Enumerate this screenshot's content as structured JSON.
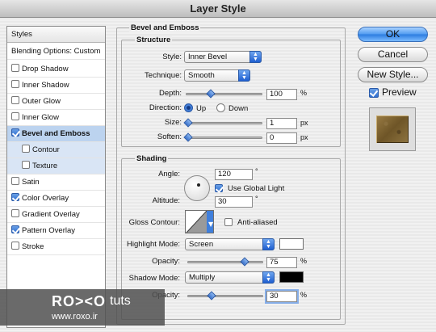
{
  "window": {
    "title": "Layer Style"
  },
  "sidebar": {
    "header": "Styles",
    "blending": "Blending Options: Custom",
    "items": [
      {
        "label": "Drop Shadow",
        "checked": false
      },
      {
        "label": "Inner Shadow",
        "checked": false
      },
      {
        "label": "Outer Glow",
        "checked": false
      },
      {
        "label": "Inner Glow",
        "checked": false
      },
      {
        "label": "Bevel and Emboss",
        "checked": true
      },
      {
        "label": "Contour",
        "checked": false
      },
      {
        "label": "Texture",
        "checked": false
      },
      {
        "label": "Satin",
        "checked": false
      },
      {
        "label": "Color Overlay",
        "checked": true
      },
      {
        "label": "Gradient Overlay",
        "checked": false
      },
      {
        "label": "Pattern Overlay",
        "checked": true
      },
      {
        "label": "Stroke",
        "checked": false
      }
    ]
  },
  "bevel": {
    "title": "Bevel and Emboss",
    "structure_title": "Structure",
    "style_label": "Style:",
    "style_value": "Inner Bevel",
    "technique_label": "Technique:",
    "technique_value": "Smooth",
    "depth_label": "Depth:",
    "depth_value": "100",
    "depth_unit": "%",
    "direction_label": "Direction:",
    "direction_up": "Up",
    "direction_down": "Down",
    "size_label": "Size:",
    "size_value": "1",
    "size_unit": "px",
    "soften_label": "Soften:",
    "soften_value": "0",
    "soften_unit": "px"
  },
  "shading": {
    "title": "Shading",
    "angle_label": "Angle:",
    "angle_value": "120",
    "angle_unit": "°",
    "global_light_label": "Use Global Light",
    "altitude_label": "Altitude:",
    "altitude_value": "30",
    "altitude_unit": "°",
    "gloss_label": "Gloss Contour:",
    "anti_aliased_label": "Anti-aliased",
    "highlight_mode_label": "Highlight Mode:",
    "highlight_mode_value": "Screen",
    "highlight_color": "#ffffff",
    "highlight_opacity_label": "Opacity:",
    "highlight_opacity_value": "75",
    "highlight_opacity_unit": "%",
    "shadow_mode_label": "Shadow Mode:",
    "shadow_mode_value": "Multiply",
    "shadow_color": "#000000",
    "shadow_opacity_label": "Opacity:",
    "shadow_opacity_value": "30",
    "shadow_opacity_unit": "%"
  },
  "buttons": {
    "ok": "OK",
    "cancel": "Cancel",
    "new_style": "New Style...",
    "preview": "Preview"
  },
  "watermark": {
    "brand": "RO><O",
    "tuts": "tuts",
    "url": "www.roxo.ir"
  }
}
